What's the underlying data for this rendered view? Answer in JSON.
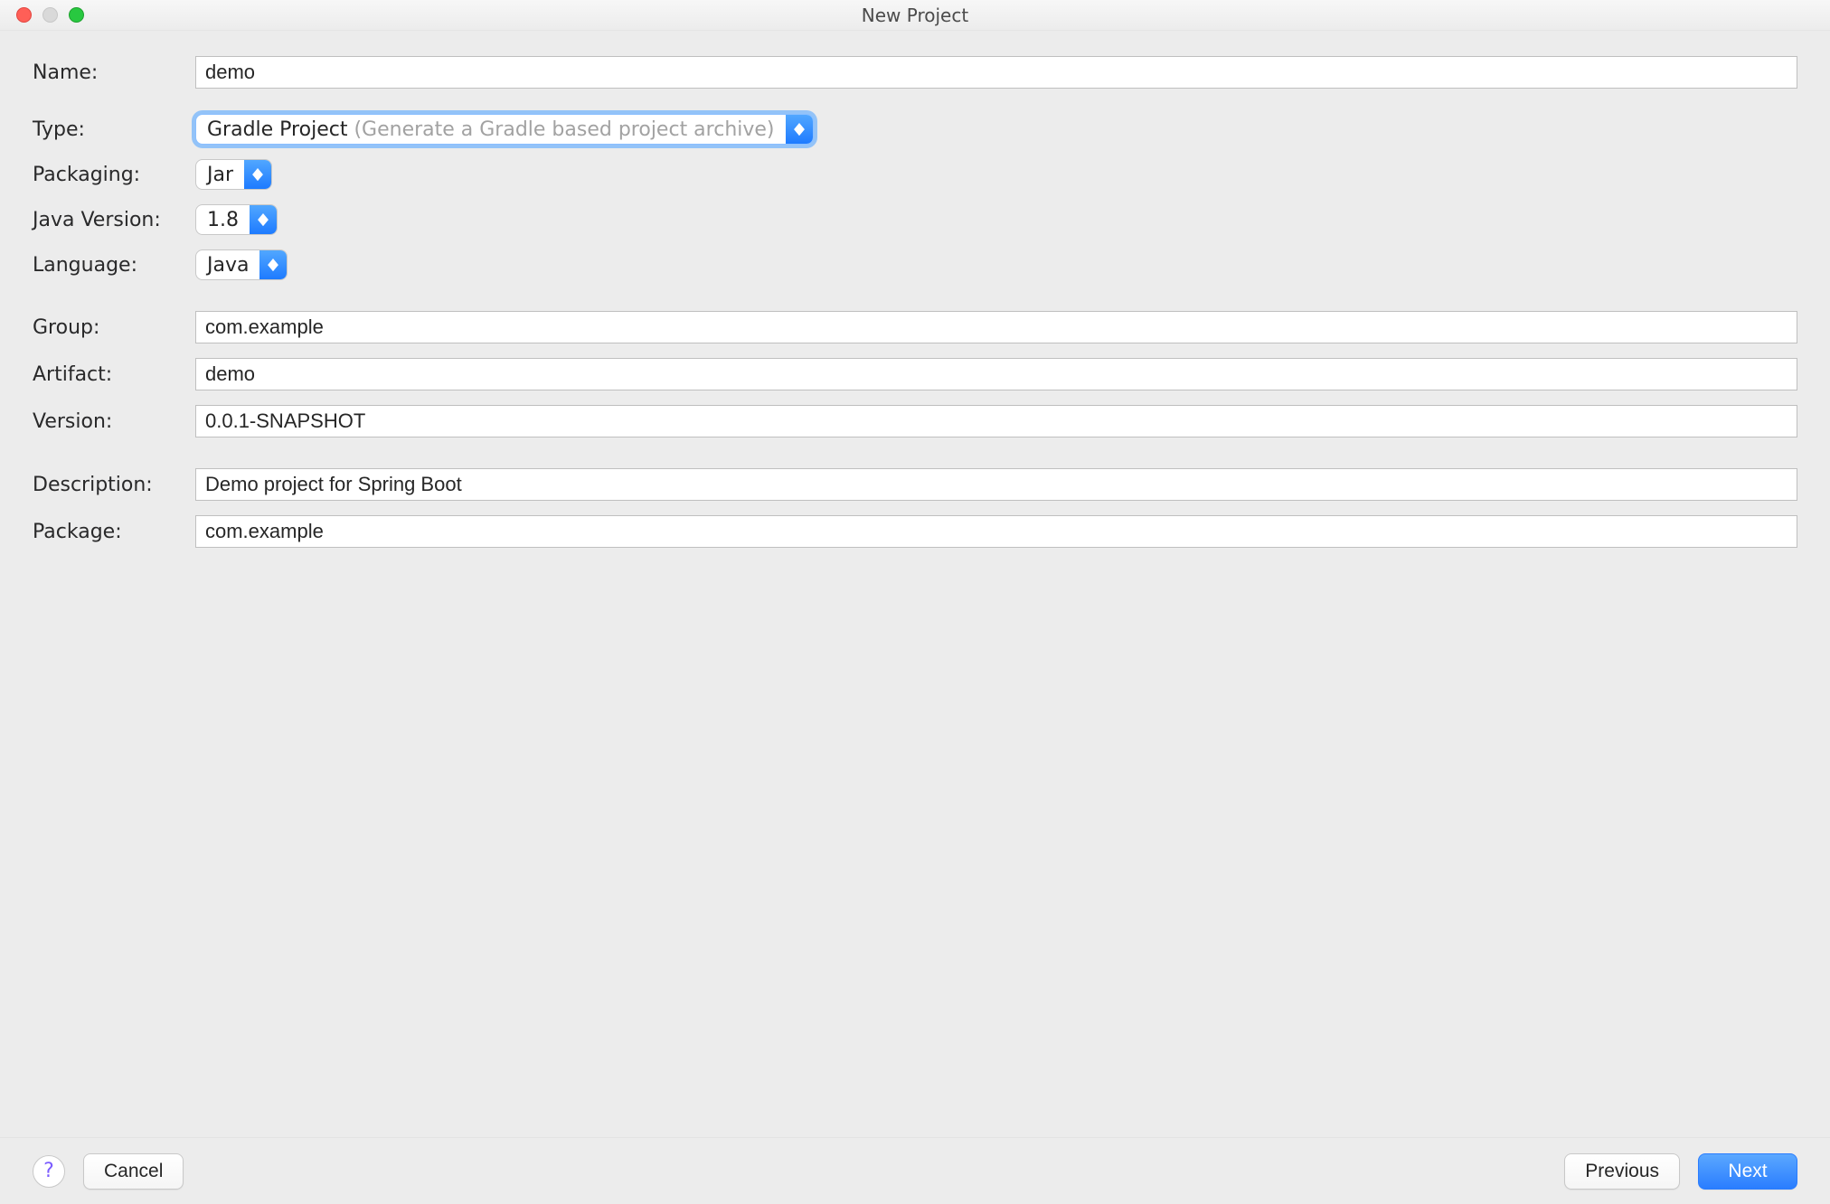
{
  "window": {
    "title": "New Project"
  },
  "labels": {
    "name": "Name:",
    "type": "Type:",
    "packaging": "Packaging:",
    "javaVersion": "Java Version:",
    "language": "Language:",
    "group": "Group:",
    "artifact": "Artifact:",
    "version": "Version:",
    "description": "Description:",
    "package": "Package:"
  },
  "fields": {
    "name": "demo",
    "type": {
      "value": "Gradle Project",
      "hint": "(Generate a Gradle based project archive)"
    },
    "packaging": "Jar",
    "javaVersion": "1.8",
    "language": "Java",
    "group": "com.example",
    "artifact": "demo",
    "version": "0.0.1-SNAPSHOT",
    "description": "Demo project for Spring Boot",
    "package": "com.example"
  },
  "footer": {
    "help": "?",
    "cancel": "Cancel",
    "previous": "Previous",
    "next": "Next"
  }
}
